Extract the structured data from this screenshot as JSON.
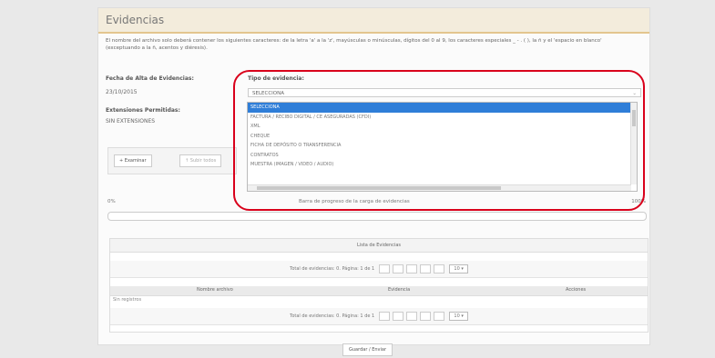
{
  "panel": {
    "title": "Evidencias"
  },
  "description": "El nombre del archivo solo deberá contener los siguientes caracteres: de la letra 'a' a la 'z', mayúsculas o minúsculas, dígitos del 0 al 9, los caracteres especiales _ - . ( ), la ñ y el 'espacio en blanco' (exceptuando a la ñ, acentos y diéresis).",
  "fields": {
    "fecha_label": "Fecha de Alta de Evidencias:",
    "fecha_value": "23/10/2015",
    "tipo_label": "Tipo de evidencia:",
    "tipo_value": "SELECCIONA",
    "extensiones_label": "Extensiones Permitidas:",
    "extensiones_value": "SIN EXTENSIONES"
  },
  "dropdown": {
    "options": [
      "SELECCIONA",
      "FACTURA / RECIBO DIGITAL / CE ASEGURADAS (CFDI)",
      "XML",
      "CHEQUE",
      "FICHA DE DEPÓSITO O TRANSFERENCIA",
      "CONTRATOS",
      "MUESTRA (IMAGEN / VIDEO / AUDIO)"
    ],
    "selected_index": 0
  },
  "toolbar": {
    "examinar_label": "+ Examinar",
    "subir_label": "↑ Subir todos"
  },
  "upload": {
    "percent_label": "0%",
    "status_label": "Barra de progreso de la carga de evidencias",
    "percent_right": "100%",
    "progress": 0
  },
  "grid": {
    "caption": "Lista de Evidencias",
    "pager_text": "Total de evidencias: 0. Página: 1 de 1",
    "page_size": "10",
    "columns": [
      "Nombre archivo",
      "Evidencia",
      "Acciones"
    ],
    "empty_text": "Sin registros"
  },
  "footer": {
    "save_label": "Guardar / Enviar"
  }
}
